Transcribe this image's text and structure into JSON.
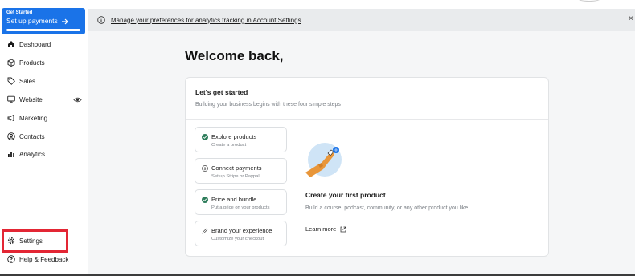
{
  "sidebar": {
    "get_started": {
      "title": "Get Started",
      "label": "Set up payments",
      "progress": 1.0
    },
    "items": [
      {
        "label": "Dashboard",
        "icon": "home-icon"
      },
      {
        "label": "Products",
        "icon": "box-icon"
      },
      {
        "label": "Sales",
        "icon": "tag-icon"
      },
      {
        "label": "Website",
        "icon": "monitor-icon"
      },
      {
        "label": "Marketing",
        "icon": "megaphone-icon"
      },
      {
        "label": "Contacts",
        "icon": "user-circle-icon"
      },
      {
        "label": "Analytics",
        "icon": "bar-chart-icon"
      }
    ],
    "bottom_items": [
      {
        "label": "Settings",
        "icon": "gear-icon"
      },
      {
        "label": "Help & Feedback",
        "icon": "help-icon"
      }
    ],
    "highlight_color": "#e32634"
  },
  "banner": {
    "text": "Manage your preferences for analytics tracking in Account Settings",
    "close": "×"
  },
  "main": {
    "welcome": "Welcome back,",
    "card": {
      "title": "Let's get started",
      "subtitle": "Building your business begins with these four simple steps",
      "steps": [
        {
          "title": "Explore products",
          "subtitle": "Create a product",
          "status": "done"
        },
        {
          "title": "Connect payments",
          "subtitle": "Set up Stripe or Paypal",
          "status": "dollar"
        },
        {
          "title": "Price and bundle",
          "subtitle": "Put a price on your products",
          "status": "done"
        },
        {
          "title": "Brand your experience",
          "subtitle": "Customize your checkout",
          "status": "pencil"
        }
      ],
      "feature_title": "Create your first product",
      "feature_subtitle": "Build a course, podcast, community, or any other product you like.",
      "learn_more": "Learn more"
    }
  },
  "colors": {
    "accent": "#1a73e8",
    "success": "#2e7d5b"
  }
}
